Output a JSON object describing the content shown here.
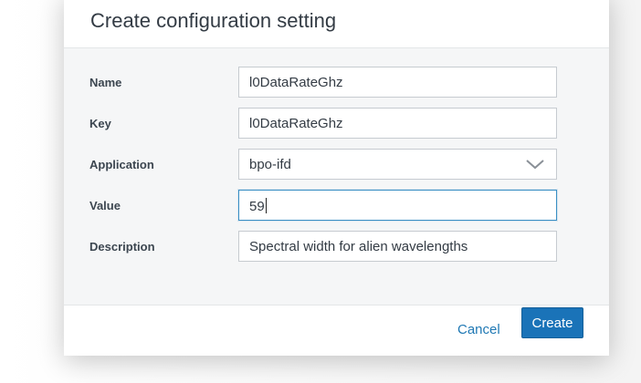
{
  "modal": {
    "title": "Create configuration setting"
  },
  "form": {
    "name": {
      "label": "Name",
      "value": "l0DataRateGhz"
    },
    "key": {
      "label": "Key",
      "value": "l0DataRateGhz"
    },
    "application": {
      "label": "Application",
      "value": "bpo-ifd",
      "icon": "chevron-down-icon"
    },
    "value": {
      "label": "Value",
      "value": "59"
    },
    "description": {
      "label": "Description",
      "value": "Spectral width for alien wavelengths"
    }
  },
  "footer": {
    "cancel_label": "Cancel",
    "create_label": "Create"
  },
  "colors": {
    "primary": "#1a73b8",
    "link": "#1f78b4",
    "focus_border": "#3a8fc4",
    "body_bg": "#f5f6f7"
  }
}
